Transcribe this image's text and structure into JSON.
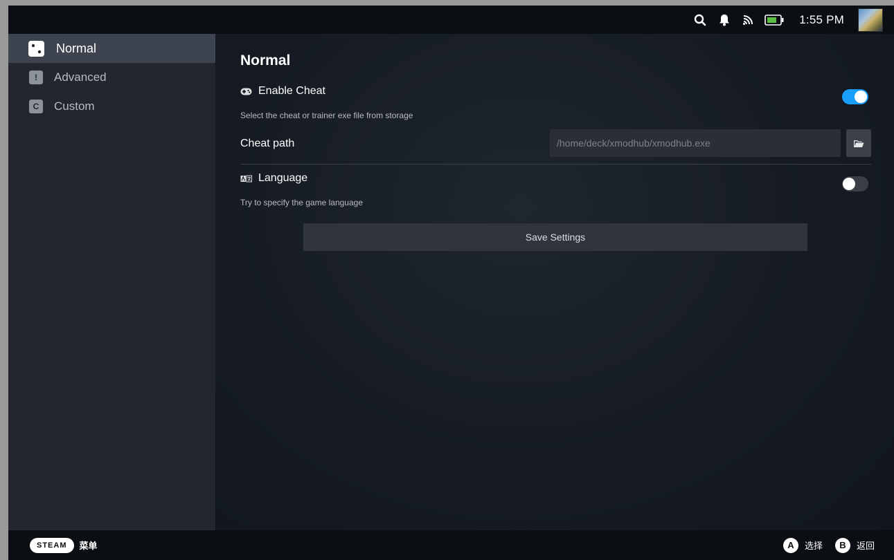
{
  "statusbar": {
    "icons": [
      "search-icon",
      "bell-icon",
      "cast-icon",
      "battery-icon"
    ],
    "time": "1:55 PM"
  },
  "sidebar": {
    "items": [
      {
        "label": "Normal",
        "badge": "",
        "active": true
      },
      {
        "label": "Advanced",
        "badge": "!",
        "active": false
      },
      {
        "label": "Custom",
        "badge": "C",
        "active": false
      }
    ]
  },
  "main": {
    "title": "Normal",
    "enable_cheat": {
      "label": "Enable Cheat",
      "description": "Select the cheat or trainer exe file from storage",
      "enabled": true
    },
    "cheat_path": {
      "label": "Cheat path",
      "placeholder": "/home/deck/xmodhub/xmodhub.exe"
    },
    "language": {
      "label": "Language",
      "description": "Try to specify the game language",
      "enabled": false
    },
    "save_label": "Save Settings"
  },
  "bottombar": {
    "steam_label": "STEAM",
    "menu_label": "菜单",
    "hints": [
      {
        "button": "A",
        "label": "选择"
      },
      {
        "button": "B",
        "label": "返回"
      }
    ]
  },
  "colors": {
    "accent": "#1a9fff",
    "battery": "#59bf40"
  }
}
